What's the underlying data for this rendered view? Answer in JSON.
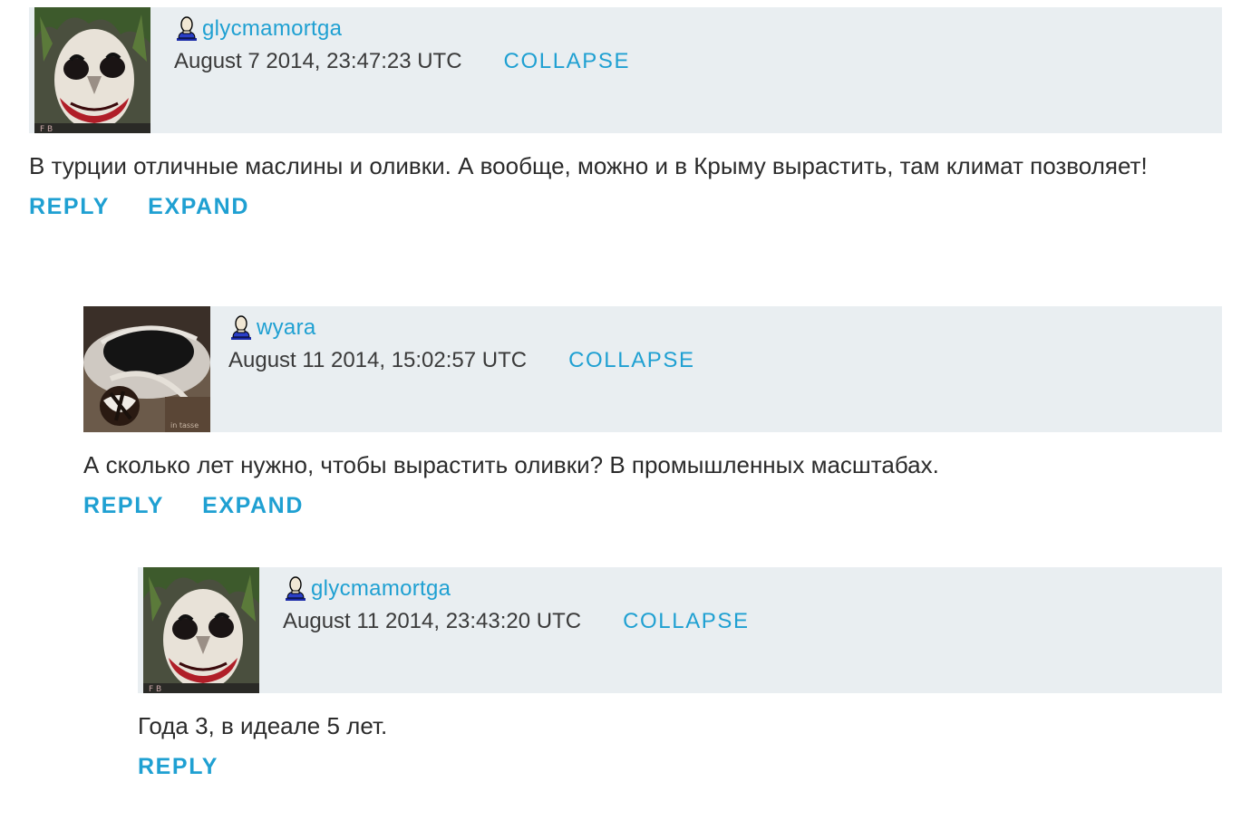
{
  "comments": [
    {
      "author": "glycmamortga",
      "timestamp": "August 7 2014, 23:47:23 UTC",
      "collapse_label": "COLLAPSE",
      "avatar_icon": "joker-face-avatar",
      "body": "В турции отличные маслины и оливки. А вообще, можно и в Крыму вырастить, там климат позволяет!",
      "reply_label": "REPLY",
      "expand_label": "EXPAND"
    },
    {
      "author": "wyara",
      "timestamp": "August 11 2014, 15:02:57 UTC",
      "collapse_label": "COLLAPSE",
      "avatar_icon": "teacup-photo-avatar",
      "body": "А сколько лет нужно, чтобы вырастить оливки? В промышленных масштабах.",
      "reply_label": "REPLY",
      "expand_label": "EXPAND"
    },
    {
      "author": "glycmamortga",
      "timestamp": "August 11 2014, 23:43:20 UTC",
      "collapse_label": "COLLAPSE",
      "avatar_icon": "joker-face-avatar",
      "body": "Года 3, в идеале 5 лет.",
      "reply_label": "REPLY"
    }
  ],
  "colors": {
    "link": "#1fa0d2",
    "header_bg": "#e9eef1",
    "text": "#2b2b2b"
  }
}
